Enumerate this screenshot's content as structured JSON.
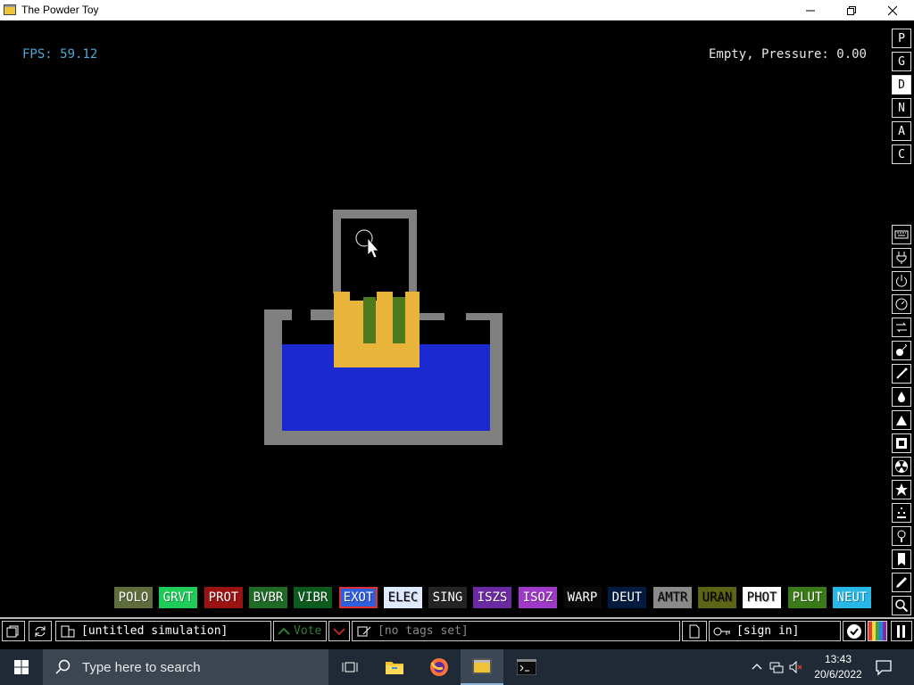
{
  "window": {
    "title": "The Powder Toy",
    "controls": [
      "minimize-icon",
      "maximize-icon",
      "close-icon"
    ]
  },
  "hud": {
    "fps": "FPS: 59.12",
    "cursor_info": "Empty, Pressure: 0.00"
  },
  "render_modes": [
    "P",
    "G",
    "D",
    "N",
    "A",
    "C"
  ],
  "render_mode_active": "D",
  "category_icons": [
    "keyboard-icon",
    "electronics-plug-icon",
    "powered-icon",
    "sensor-icon",
    "force-icon",
    "explosives-icon",
    "gas-icon",
    "liquid-icon",
    "powder-icon",
    "solids-icon",
    "radioactive-icon",
    "special-icon",
    "life-icon",
    "tools-icon",
    "save-icon",
    "pen-icon",
    "zoom-icon"
  ],
  "palette": {
    "elements": [
      {
        "label": "POLO",
        "bg": "#5f6d3d",
        "fg": "#ffffff"
      },
      {
        "label": "GRVT",
        "bg": "#1fcc5a",
        "fg": "#ffffff"
      },
      {
        "label": "PROT",
        "bg": "#9b1212",
        "fg": "#ffffff"
      },
      {
        "label": "BVBR",
        "bg": "#1f6b26",
        "fg": "#ffffff"
      },
      {
        "label": "VIBR",
        "bg": "#0b5b1e",
        "fg": "#ffffff"
      },
      {
        "label": "EXOT",
        "bg": "#2f5fdc",
        "fg": "#ffffff"
      },
      {
        "label": "ELEC",
        "bg": "#dfeaff",
        "fg": "#000000"
      },
      {
        "label": "SING",
        "bg": "#242424",
        "fg": "#ffffff"
      },
      {
        "label": "ISZS",
        "bg": "#6c2aa2",
        "fg": "#ffffff"
      },
      {
        "label": "ISOZ",
        "bg": "#9f3ac8",
        "fg": "#ffffff"
      },
      {
        "label": "WARP",
        "bg": "#0a0a0a",
        "fg": "#ffffff"
      },
      {
        "label": "DEUT",
        "bg": "#001a40",
        "fg": "#ffffff"
      },
      {
        "label": "AMTR",
        "bg": "#8a8a8a",
        "fg": "#000000"
      },
      {
        "label": "URAN",
        "bg": "#5d6416",
        "fg": "#000000"
      },
      {
        "label": "PHOT",
        "bg": "#ffffff",
        "fg": "#000000"
      },
      {
        "label": "PLUT",
        "bg": "#3b7a18",
        "fg": "#ffffff"
      },
      {
        "label": "NEUT",
        "bg": "#28b8e6",
        "fg": "#ffffff"
      }
    ],
    "selected": "EXOT"
  },
  "toolbar": {
    "save_name": "[untitled simulation]",
    "vote_label": "Vote",
    "tags": "[no tags set]",
    "sign_in": "[sign in]"
  },
  "taskbar": {
    "search_placeholder": "Type here to search",
    "apps": [
      "task-view-icon",
      "file-explorer-icon",
      "firefox-icon",
      "powder-toy-icon",
      "terminal-icon"
    ],
    "time": "13:43",
    "date": "20/6/2022"
  }
}
